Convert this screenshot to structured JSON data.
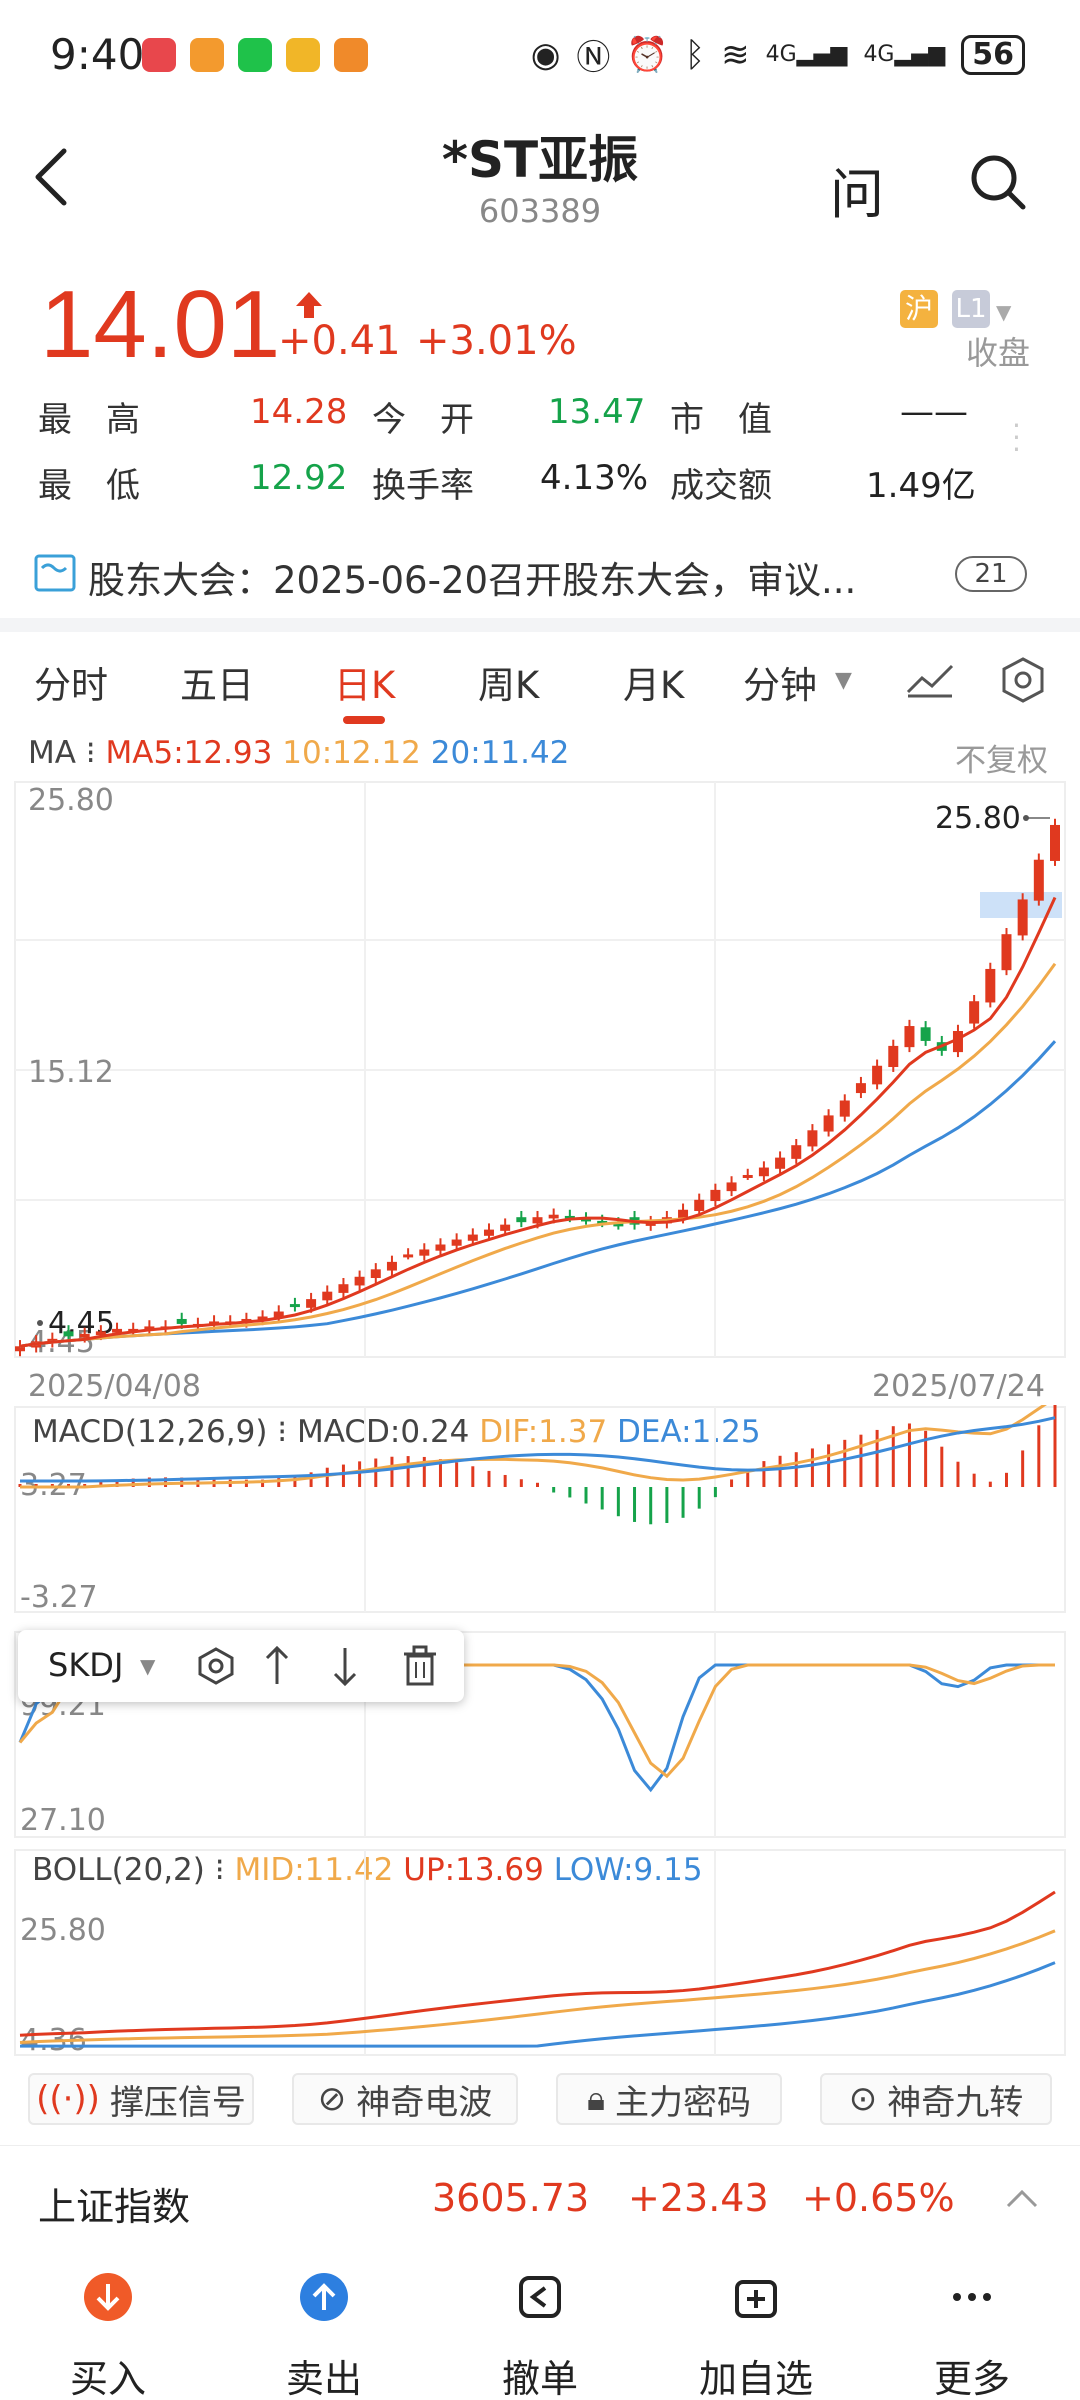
{
  "status_bar": {
    "time": "9:40",
    "app_icons": [
      "huawei-app",
      "love-app",
      "iqiyi-app",
      "game-app",
      "orange-app"
    ],
    "network_1": "4G",
    "network_2": "4G",
    "battery": "56"
  },
  "header": {
    "title": "*ST亚振",
    "code": "603389",
    "ask_label": "问"
  },
  "quote": {
    "price": "14.01",
    "change": "+0.41",
    "change_pct": "+3.01%",
    "exchange_badge": "沪",
    "level_badge": "L1",
    "status": "收盘",
    "high_label": "最　高",
    "high": "14.28",
    "open_label": "今　开",
    "open": "13.47",
    "mcap_label": "市　值",
    "mcap": "——",
    "low_label": "最　低",
    "low": "12.92",
    "turnover_label": "换手率",
    "turnover": "4.13%",
    "amount_label": "成交额",
    "amount": "1.49亿"
  },
  "news": {
    "text": "股东大会：2025-06-20召开股东大会，审议...",
    "count": "21"
  },
  "tabs": [
    "分时",
    "五日",
    "日K",
    "周K",
    "月K",
    "分钟"
  ],
  "active_tab": "日K",
  "ma_legend": {
    "label": "MA",
    "ma5": "MA5:12.93",
    "ma10": "10:12.12",
    "ma20": "20:11.42",
    "fuquan": "不复权"
  },
  "main_chart": {
    "y_top": "25.80",
    "y_mid": "15.12",
    "y_bottom": "4.45",
    "max_label": "25.80",
    "min_label": "4.45",
    "date_start": "2025/04/08",
    "date_end": "2025/07/24"
  },
  "macd": {
    "label": "MACD(12,26,9)",
    "macd": "MACD:0.24",
    "dif": "DIF:1.37",
    "dea": "DEA:1.25",
    "y_top": "3.27",
    "y_bottom": "-3.27"
  },
  "skdj": {
    "label": "SKDJ",
    "y_top": "99.21",
    "y_bottom": "27.10"
  },
  "boll": {
    "label": "BOLL(20,2)",
    "mid": "MID:11.42",
    "up": "UP:13.69",
    "low": "LOW:9.15",
    "y_top": "25.80",
    "y_bottom": "4.36"
  },
  "features": [
    "撑压信号",
    "神奇电波",
    "主力密码",
    "神奇九转"
  ],
  "index_bar": {
    "name": "上证指数",
    "value": "3605.73",
    "change": "+23.43",
    "change_pct": "+0.65%"
  },
  "bottom_nav": [
    "买入",
    "卖出",
    "撤单",
    "加自选",
    "更多"
  ],
  "colors": {
    "up": "#e0391f",
    "down": "#15a34a",
    "ma5": "#e0391f",
    "ma10": "#f0a94a",
    "ma20": "#3c8ad8",
    "buy": "#f05a28",
    "sell": "#2d7fe0"
  },
  "chart_data": {
    "type": "candlestick",
    "x_range": [
      "2025/04/08",
      "2025/07/24"
    ],
    "ylim": [
      4.45,
      25.8
    ],
    "series": [
      {
        "name": "MA5",
        "value": 12.93
      },
      {
        "name": "MA10",
        "value": 12.12
      },
      {
        "name": "MA20",
        "value": 11.42
      }
    ],
    "close_series": [
      4.6,
      4.8,
      4.9,
      5.0,
      5.1,
      5.2,
      5.3,
      5.3,
      5.4,
      5.4,
      5.5,
      5.5,
      5.6,
      5.6,
      5.7,
      5.8,
      6.0,
      6.2,
      6.5,
      6.8,
      7.1,
      7.4,
      7.7,
      8.0,
      8.3,
      8.5,
      8.7,
      8.9,
      9.1,
      9.3,
      9.5,
      9.6,
      9.8,
      9.9,
      9.8,
      9.7,
      9.6,
      9.5,
      9.5,
      9.6,
      9.8,
      10.1,
      10.5,
      10.9,
      11.2,
      11.5,
      11.8,
      12.2,
      12.7,
      13.3,
      13.9,
      14.5,
      15.2,
      15.9,
      16.7,
      17.5,
      16.9,
      16.5,
      17.3,
      18.5,
      19.8,
      21.2,
      22.6,
      24.2,
      25.6
    ]
  }
}
